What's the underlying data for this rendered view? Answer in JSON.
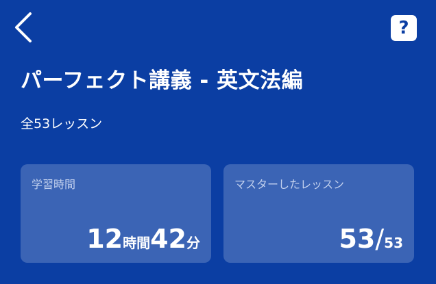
{
  "header": {
    "back_icon": "chevron-left-icon",
    "help_label": "?",
    "help_icon": "question-icon"
  },
  "course": {
    "title": "パーフェクト講義 - 英文法編",
    "lesson_count": "全53レッスン"
  },
  "stats": {
    "study_time": {
      "label": "学習時間",
      "hours": "12",
      "hours_unit": "時間",
      "minutes": "42",
      "minutes_unit": "分"
    },
    "mastered": {
      "label": "マスターしたレッスン",
      "count": "53",
      "separator": "/",
      "total": "53"
    }
  },
  "colors": {
    "background": "#0b3ea3",
    "card": "rgba(255,255,255,0.2)",
    "label": "#c3d1ee"
  }
}
